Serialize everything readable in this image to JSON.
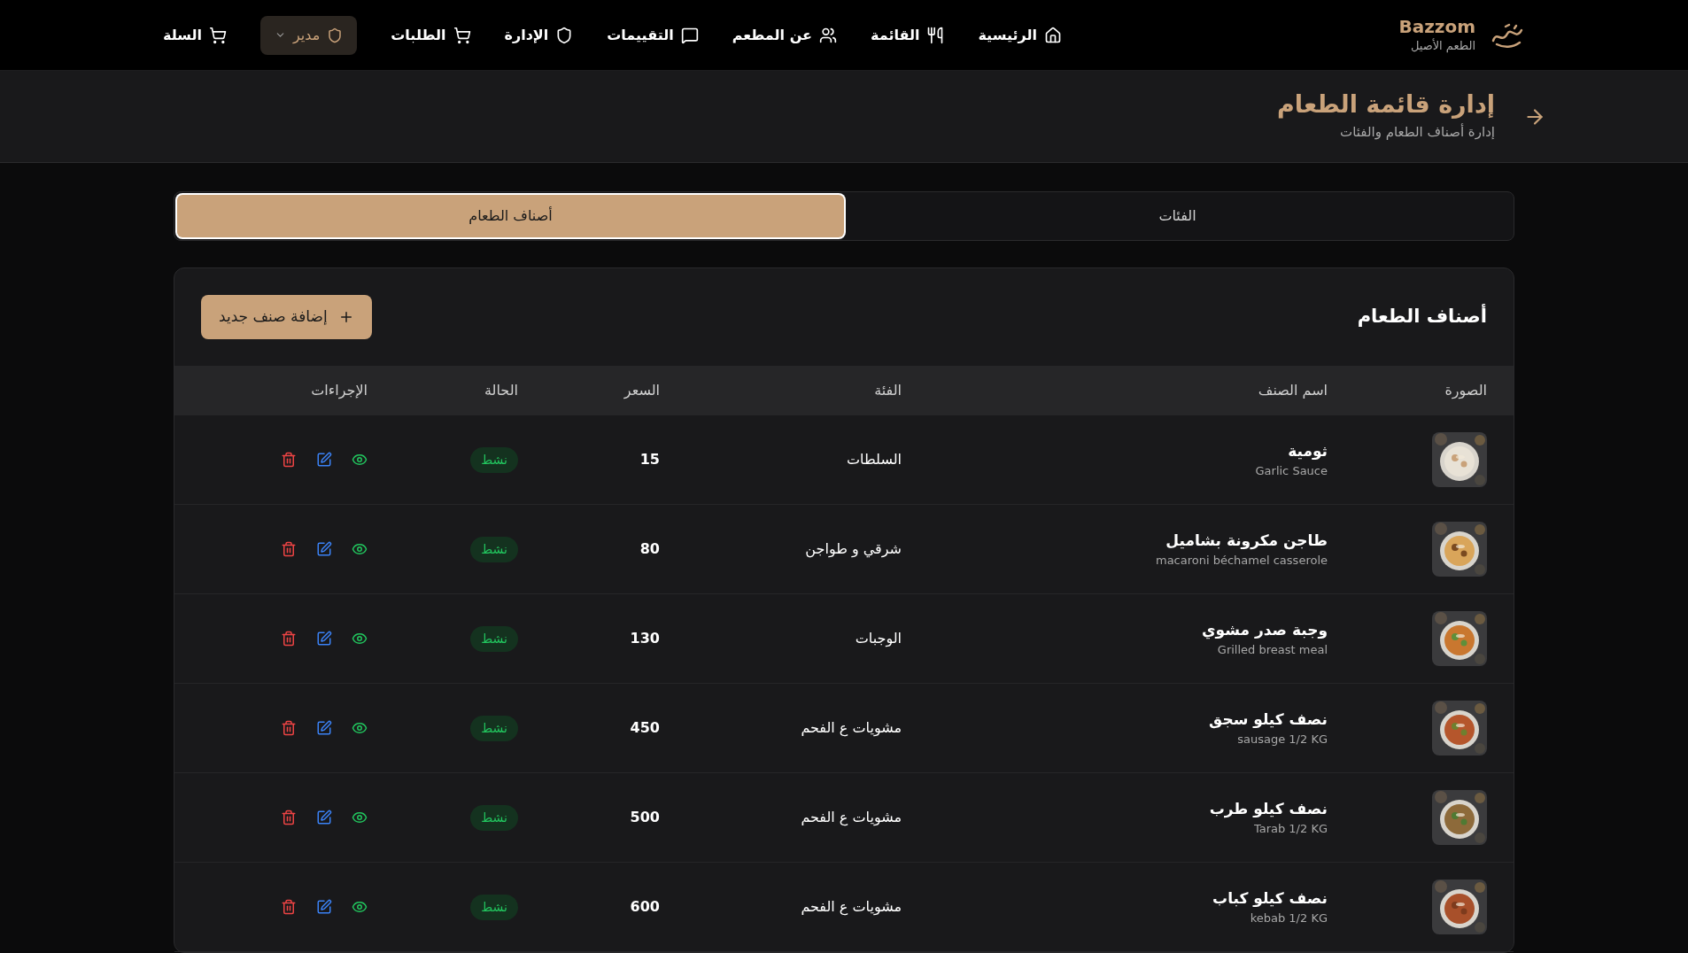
{
  "brand": {
    "name": "Bazzom",
    "tagline": "الطعم الأصيل"
  },
  "nav": [
    {
      "label": "الرئيسية",
      "kind": "home"
    },
    {
      "label": "القائمة",
      "kind": "menu"
    },
    {
      "label": "عن المطعم",
      "kind": "about"
    },
    {
      "label": "التقييمات",
      "kind": "reviews"
    },
    {
      "label": "الإدارة",
      "kind": "admin"
    },
    {
      "label": "الطلبات",
      "kind": "orders"
    },
    {
      "label": "مدير",
      "kind": "user"
    },
    {
      "label": "السلة",
      "kind": "cart"
    }
  ],
  "page": {
    "title": "إدارة قائمة الطعام",
    "subtitle": "إدارة أصناف الطعام والفئات"
  },
  "tabs": [
    {
      "label": "الفئات",
      "selected": false
    },
    {
      "label": "أصناف الطعام",
      "selected": true
    }
  ],
  "card": {
    "title": "أصناف الطعام",
    "add_button": "إضافة صنف جديد"
  },
  "table": {
    "columns": [
      "الصورة",
      "اسم الصنف",
      "الفئة",
      "السعر",
      "الحالة",
      "الإجراءات"
    ],
    "rows": [
      {
        "name": "ثومية",
        "name_en": "Garlic Sauce",
        "category": "السلطات",
        "price": "15",
        "status": "نشط",
        "active": true
      },
      {
        "name": "طاجن مكرونة بشاميل",
        "name_en": "macaroni béchamel casserole",
        "category": "شرقي و طواجن",
        "price": "80",
        "status": "نشط",
        "active": true
      },
      {
        "name": "وجبة صدر مشوي",
        "name_en": "Grilled breast meal",
        "category": "الوجبات",
        "price": "130",
        "status": "نشط",
        "active": true
      },
      {
        "name": "نصف كيلو سجق",
        "name_en": "sausage 1/2 KG",
        "category": "مشويات ع الفحم",
        "price": "450",
        "status": "نشط",
        "active": true
      },
      {
        "name": "نصف كيلو طرب",
        "name_en": "Tarab 1/2 KG",
        "category": "مشويات ع الفحم",
        "price": "500",
        "status": "نشط",
        "active": true
      },
      {
        "name": "نصف كيلو كباب",
        "name_en": "kebab 1/2 KG",
        "category": "مشويات ع الفحم",
        "price": "600",
        "status": "نشط",
        "active": true
      }
    ]
  }
}
